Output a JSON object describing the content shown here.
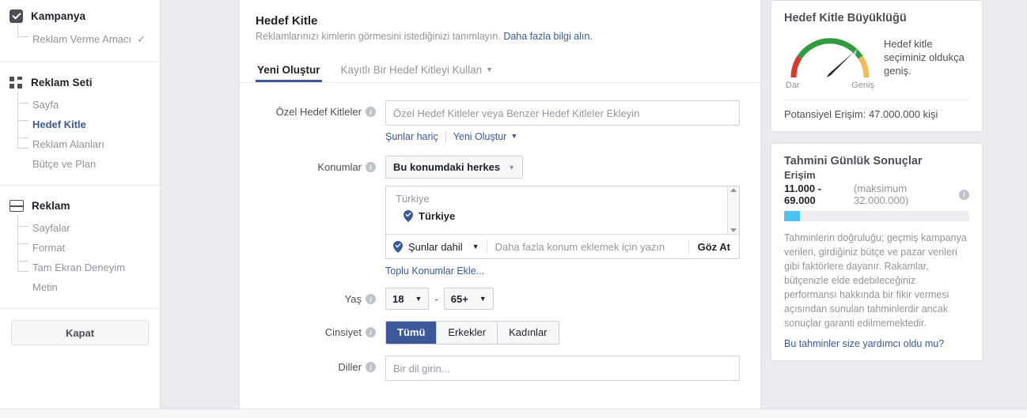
{
  "sidebar": {
    "sections": [
      {
        "title": "Kampanya",
        "icon": "checkbox-icon",
        "items": [
          {
            "label": "Reklam Verme Amacı",
            "state": "done",
            "tick": "✓"
          }
        ]
      },
      {
        "title": "Reklam Seti",
        "icon": "grid-icon",
        "items": [
          {
            "label": "Sayfa",
            "state": "normal"
          },
          {
            "label": "Hedef Kitle",
            "state": "active"
          },
          {
            "label": "Reklam Alanları",
            "state": "normal"
          },
          {
            "label": "Bütçe ve Plan",
            "state": "normal"
          }
        ]
      },
      {
        "title": "Reklam",
        "icon": "window-icon",
        "items": [
          {
            "label": "Sayfalar",
            "state": "normal"
          },
          {
            "label": "Format",
            "state": "normal"
          },
          {
            "label": "Tam Ekran Deneyim",
            "state": "normal"
          },
          {
            "label": "Metin",
            "state": "normal"
          }
        ]
      }
    ],
    "close_button": "Kapat"
  },
  "main": {
    "title": "Hedef Kitle",
    "subtitle": "Reklamlarınızı kimlerin görmesini istediğinizi tanımlayın.",
    "subtitle_link": "Daha fazla bilgi alın.",
    "tabs": [
      {
        "label": "Yeni Oluştur",
        "active": true
      },
      {
        "label": "Kayıtlı Bir Hedef Kitleyi Kullan",
        "active": false,
        "caret": "▼"
      }
    ],
    "fields": {
      "custom_audiences": {
        "label": "Özel Hedef Kitleler",
        "placeholder": "Özel Hedef Kitleler veya Benzer Hedef Kitleler Ekleyin",
        "value": "",
        "link_exclude": "Şunlar hariç",
        "link_create": "Yeni Oluştur",
        "link_create_caret": "▼"
      },
      "locations": {
        "label": "Konumlar",
        "mode_value": "Bu konumdaki herkes",
        "mode_caret": "▼",
        "group_label": "Türkiye",
        "selected": [
          "Türkiye"
        ],
        "include_label": "Şunlar dahil",
        "include_caret": "▼",
        "search_placeholder": "Daha fazla konum eklemek için yazın",
        "browse_label": "Göz At",
        "bulk_link": "Toplu Konumlar Ekle..."
      },
      "age": {
        "label": "Yaş",
        "min": "18",
        "max": "65+",
        "separator": "-",
        "caret": "▼"
      },
      "gender": {
        "label": "Cinsiyet",
        "options": [
          {
            "label": "Tümü",
            "selected": true
          },
          {
            "label": "Erkekler",
            "selected": false
          },
          {
            "label": "Kadınlar",
            "selected": false
          }
        ]
      },
      "languages": {
        "label": "Diller",
        "placeholder": "Bir dil girin...",
        "value": ""
      }
    }
  },
  "rail": {
    "audience_size": {
      "title": "Hedef Kitle Büyüklüğü",
      "gauge": {
        "left_label": "Dar",
        "right_label": "Geniş",
        "needle_fraction": 0.72,
        "colors": {
          "narrow": "#d93a2b",
          "good": "#2e9c3f",
          "broad": "#f5b955",
          "needle": "#1d2129"
        }
      },
      "description": "Hedef kitle seçiminiz oldukça geniş.",
      "reach_label": "Potansiyel Erişim:",
      "reach_value": "47.000.000 kişi"
    },
    "estimates": {
      "title": "Tahmini Günlük Sonuçlar",
      "metric_label": "Erişim",
      "range": "11.000 - 69.000",
      "max_note": "(maksimum 32.000.000)",
      "bar_fill_percent": 8.5,
      "bar_color": "#4cc2ef",
      "body": "Tahminlerin doğruluğu; geçmiş kampanya verileri, girdiğiniz bütçe ve pazar verileri gibi faktörlere dayanır. Rakamlar, bütçenizle elde edebileceğiniz performansı hakkında bir fikir vermesi açısından sunulan tahminlerdir ancak sonuçlar garanti edilmemektedir.",
      "feedback_link": "Bu tahminler size yardımcı oldu mu?"
    }
  }
}
